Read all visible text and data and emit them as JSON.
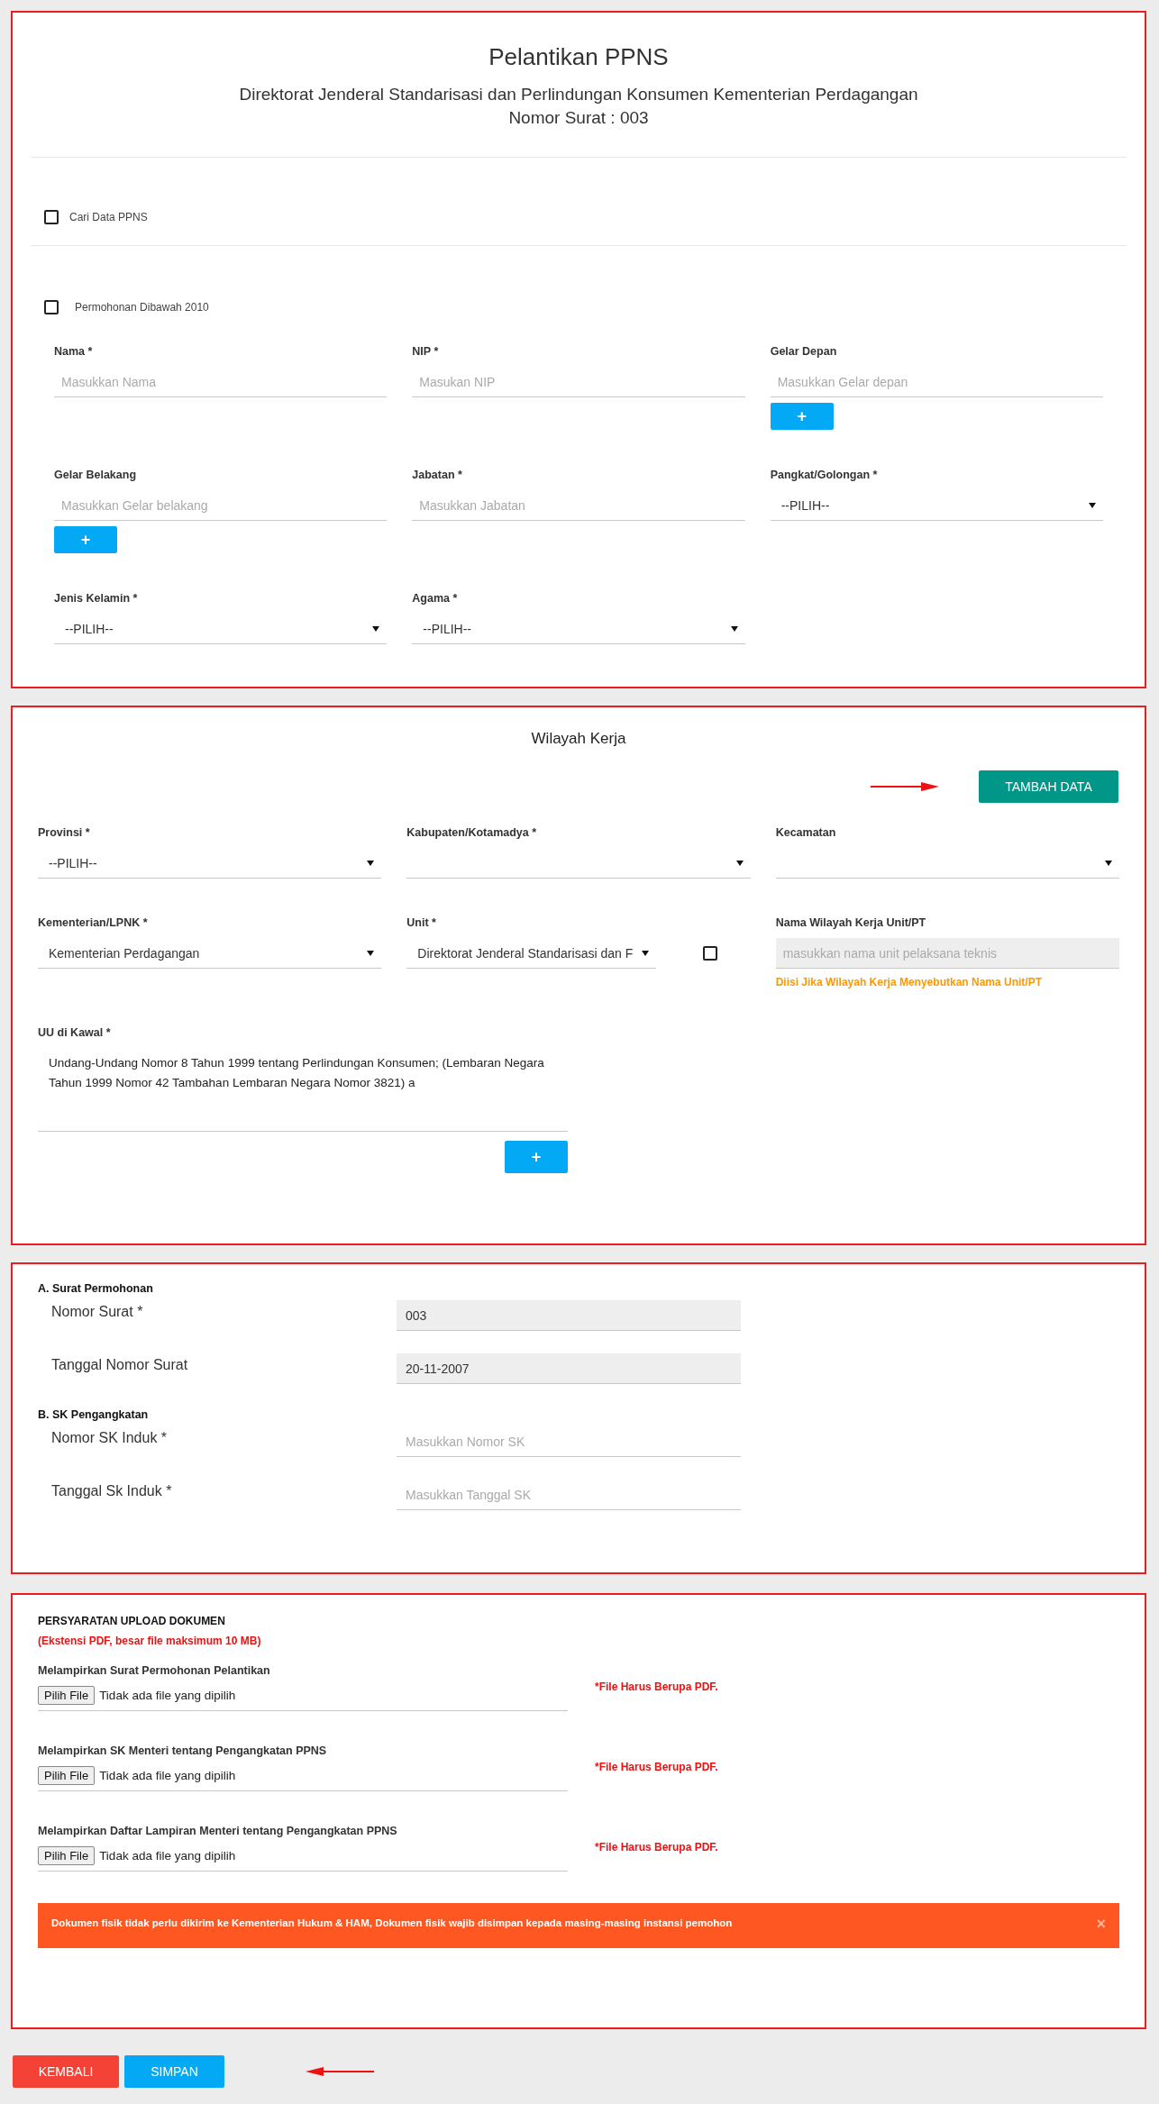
{
  "header": {
    "title": "Pelantikan PPNS",
    "subtitle": "Direktorat Jenderal Standarisasi dan Perlindungan Konsumen Kementerian Perdagangan",
    "letter_number": "Nomor Surat : 003"
  },
  "search_toggle": {
    "label": "Cari Data PPNS",
    "checked": false
  },
  "before_2010_toggle": {
    "label": "Permohonan Dibawah 2010",
    "checked": false
  },
  "personal_fields": [
    {
      "label": "Nama *",
      "kind": "input",
      "placeholder": "Masukkan Nama"
    },
    {
      "label": "NIP *",
      "kind": "input",
      "placeholder": "Masukan NIP"
    },
    {
      "label": "Gelar Depan",
      "kind": "input",
      "placeholder": "Masukkan Gelar depan",
      "add_button": "+"
    },
    {
      "label": "Gelar Belakang",
      "kind": "input",
      "placeholder": "Masukkan Gelar belakang",
      "add_button": "+"
    },
    {
      "label": "Jabatan *",
      "kind": "input",
      "placeholder": "Masukkan Jabatan"
    },
    {
      "label": "Pangkat/Golongan *",
      "kind": "select",
      "value": "--PILIH--"
    },
    {
      "label": "Jenis Kelamin *",
      "kind": "select",
      "value": "--PILIH--"
    },
    {
      "label": "Agama *",
      "kind": "select",
      "value": "--PILIH--"
    }
  ],
  "work_area": {
    "title": "Wilayah Kerja",
    "add_button": "TAMBAH DATA",
    "fields": [
      {
        "label": "Provinsi *",
        "kind": "select",
        "value": "--PILIH--"
      },
      {
        "label": "Kabupaten/Kotamadya *",
        "kind": "select"
      },
      {
        "label": "Kecamatan",
        "kind": "select"
      },
      {
        "label": "Kementerian/LPNK *",
        "kind": "select",
        "value": "Kementerian Perdagangan"
      },
      {
        "label": "Unit *",
        "kind": "select",
        "value": "Direktorat Jenderal Standarisasi dan F",
        "checkbox": {
          "checked": false
        }
      },
      {
        "label": "Nama Wilayah Kerja Unit/PT",
        "kind": "input",
        "placeholder": "masukkan nama unit pelaksana teknis",
        "disabled": true,
        "hint": "Diisi Jika Wilayah Kerja Menyebutkan Nama Unit/PT"
      }
    ],
    "law": {
      "label": "UU di Kawal *",
      "value": "Undang-Undang Nomor 8 Tahun 1999 tentang Perlindungan Konsumen; (Lembaran Negara Tahun 1999 Nomor 42 Tambahan Lembaran Negara Nomor 3821) a",
      "add_button": "+"
    }
  },
  "letters": [
    {
      "heading": "A. Surat Permohonan",
      "fields": [
        {
          "label": "Nomor Surat *",
          "value": "003",
          "disabled": true
        },
        {
          "label": "Tanggal Nomor Surat",
          "value": "20-11-2007",
          "disabled": true
        }
      ]
    },
    {
      "heading": "B. SK Pengangkatan",
      "fields": [
        {
          "label": "Nomor SK Induk *",
          "placeholder": "Masukkan Nomor SK",
          "disabled": false
        },
        {
          "label": "Tanggal Sk Induk *",
          "placeholder": "Masukkan Tanggal SK",
          "disabled": false
        }
      ]
    }
  ],
  "uploads": {
    "heading": "PERSYARATAN UPLOAD DOKUMEN",
    "note": "(Ekstensi PDF, besar file maksimum 10 MB)",
    "items": [
      {
        "label": "Melampirkan Surat Permohonan Pelantikan",
        "button": "Pilih File",
        "status": "Tidak ada file yang dipilih",
        "warning": "*File Harus Berupa PDF."
      },
      {
        "label": "Melampirkan SK Menteri tentang Pengangkatan PPNS",
        "button": "Pilih File",
        "status": "Tidak ada file yang dipilih",
        "warning": "*File Harus Berupa PDF."
      },
      {
        "label": "Melampirkan Daftar Lampiran Menteri tentang Pengangkatan PPNS",
        "button": "Pilih File",
        "status": "Tidak ada file yang dipilih",
        "warning": "*File Harus Berupa PDF."
      }
    ],
    "alert": {
      "text": "Dokumen fisik tidak perlu dikirim ke Kementerian Hukum & HAM, Dokumen fisik wajib disimpan kepada masing-masing instansi pemohon",
      "close": "×"
    }
  },
  "actions": [
    {
      "label": "KEMBALI",
      "kind": "danger"
    },
    {
      "label": "SIMPAN",
      "kind": "primary"
    }
  ]
}
